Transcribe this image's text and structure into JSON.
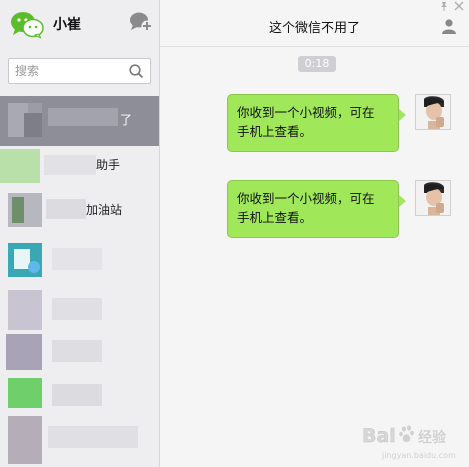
{
  "sidebar": {
    "user_name": "小崔",
    "search_placeholder": "搜索",
    "chats": [
      {
        "title": "了"
      },
      {
        "title": "助手"
      },
      {
        "title": "加油站"
      },
      {
        "title": ""
      },
      {
        "title": ""
      },
      {
        "title": ""
      },
      {
        "title": ""
      },
      {
        "title": ""
      }
    ]
  },
  "conversation": {
    "title": "这个微信不用了",
    "timestamp": "0:18",
    "messages": [
      {
        "text_line1": "你收到一个小视频，可在",
        "text_line2": "手机上查看。"
      },
      {
        "text_line1": "你收到一个小视频，可在",
        "text_line2": "手机上查看。"
      }
    ]
  },
  "colors": {
    "bubble": "#a0e75a",
    "active_chat": "#8e8e98",
    "sidebar_bg": "#eeeef1",
    "brand_green": "#4caf32"
  },
  "icons": {
    "logo": "wechat-logo",
    "new_chat": "new-chat-icon",
    "search": "search-icon",
    "profile": "profile-icon",
    "pin": "pin-icon",
    "close": "close-icon"
  },
  "watermark": {
    "text": "Baidu 经验",
    "subtext": "jingyan.baidu.com"
  }
}
